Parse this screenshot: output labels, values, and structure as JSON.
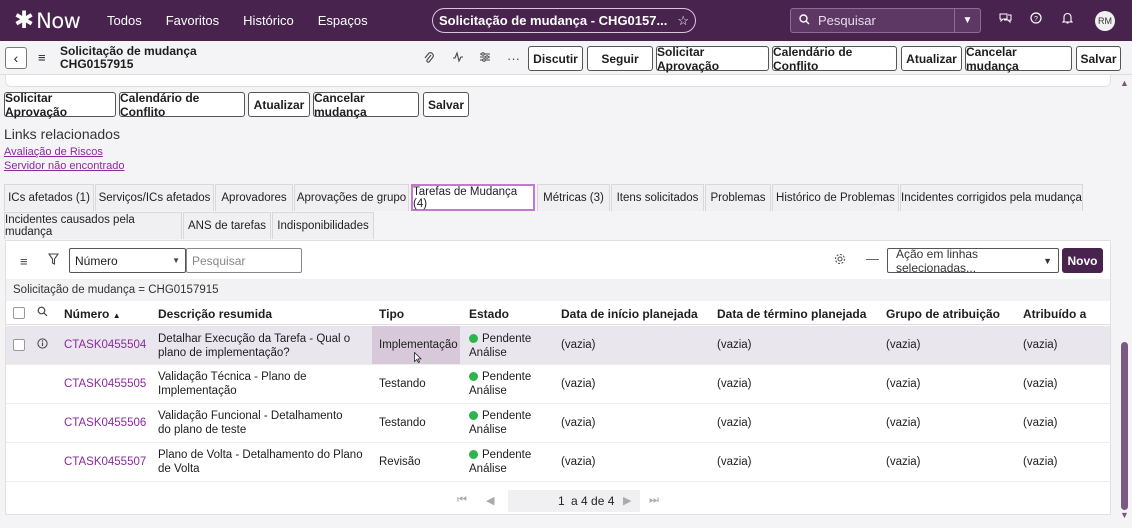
{
  "nav": {
    "logo_text": "Now",
    "links": [
      "Todos",
      "Favoritos",
      "Histórico",
      "Espaços"
    ],
    "record_pill": "Solicitação de mudança - CHG0157...",
    "search_placeholder": "Pesquisar",
    "avatar_initials": "RM"
  },
  "record": {
    "type_label": "Solicitação de mudança",
    "number": "CHG0157915"
  },
  "header_buttons": [
    "Discutir",
    "Seguir",
    "Solicitar Aprovação",
    "Calendário de Conflito",
    "Atualizar",
    "Cancelar mudança",
    "Salvar"
  ],
  "form_buttons": [
    "Solicitar Aprovação",
    "Calendário de Conflito",
    "Atualizar",
    "Cancelar mudança",
    "Salvar"
  ],
  "related_links": {
    "title": "Links relacionados",
    "items": [
      "Avaliação de Riscos",
      "Servidor não encontrado"
    ]
  },
  "tabs_row1": [
    "ICs afetados (1)",
    "Serviços/ICs afetados",
    "Aprovadores",
    "Aprovações de grupo",
    "Tarefas de Mudança (4)",
    "Métricas (3)",
    "Itens solicitados",
    "Problemas",
    "Histórico de Problemas",
    "Incidentes corrigidos pela mudança"
  ],
  "tabs_row2": [
    "Incidentes causados pela mudança",
    "ANS de tarefas",
    "Indisponibilidades"
  ],
  "active_tab": "Tarefas de Mudança (4)",
  "list": {
    "search_field": "Número",
    "search_placeholder": "Pesquisar",
    "action_select": "Ação em linhas selecionadas...",
    "new_button": "Novo",
    "breadcrumb": "Solicitação de mudança = CHG0157915",
    "columns": [
      "Número",
      "Descrição resumida",
      "Tipo",
      "Estado",
      "Data de início planejada",
      "Data de término planejada",
      "Grupo de atribuição",
      "Atribuído a"
    ],
    "sort_indicator": "▲",
    "rows": [
      {
        "number": "CTASK0455504",
        "desc": "Detalhar Execução da Tarefa - Qual o plano de implementação?",
        "type": "Implementação",
        "state": "Pendente Análise",
        "start": "(vazia)",
        "end": "(vazia)",
        "group": "(vazia)",
        "assigned": "(vazia)"
      },
      {
        "number": "CTASK0455505",
        "desc": "Validação Técnica - Plano de Implementação",
        "type": "Testando",
        "state": "Pendente Análise",
        "start": "(vazia)",
        "end": "(vazia)",
        "group": "(vazia)",
        "assigned": "(vazia)"
      },
      {
        "number": "CTASK0455506",
        "desc": "Validação Funcional - Detalhamento do plano de teste",
        "type": "Testando",
        "state": "Pendente Análise",
        "start": "(vazia)",
        "end": "(vazia)",
        "group": "(vazia)",
        "assigned": "(vazia)"
      },
      {
        "number": "CTASK0455507",
        "desc": "Plano de Volta - Detalhamento do Plano de Volta",
        "type": "Revisão",
        "state": "Pendente Análise",
        "start": "(vazia)",
        "end": "(vazia)",
        "group": "(vazia)",
        "assigned": "(vazia)"
      }
    ],
    "pager": {
      "current": "1",
      "text": "a 4 de 4"
    }
  },
  "colors": {
    "nav_bg": "#47234e",
    "link": "#8a2a9e",
    "status_green": "#2bb54a"
  }
}
